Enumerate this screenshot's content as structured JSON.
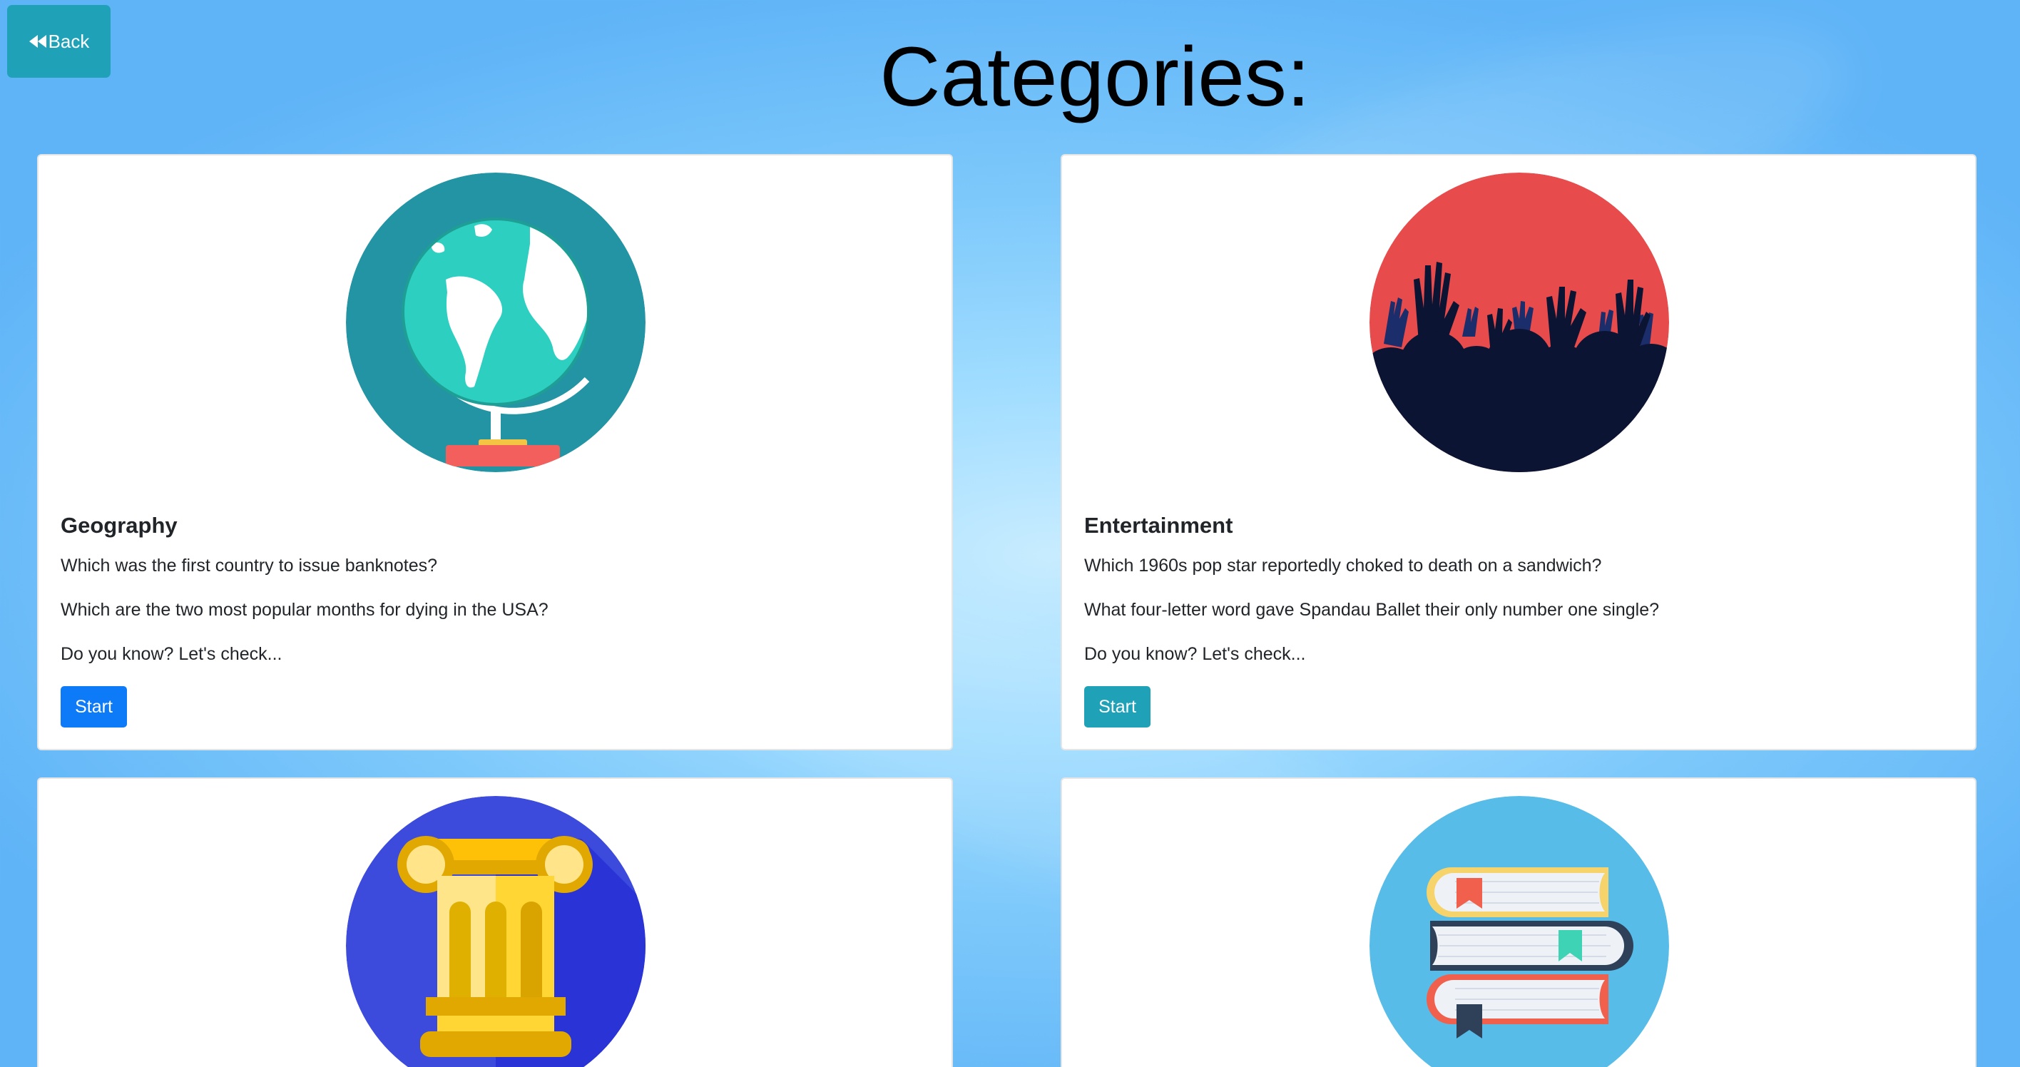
{
  "header": {
    "back_label": "Back",
    "title": "Categories:"
  },
  "colors": {
    "back_button": "#1fa2b8",
    "primary_button": "#0d7af7",
    "info_button": "#1fa2b8",
    "card_background": "#ffffff"
  },
  "cards": [
    {
      "title": "Geography",
      "icon": "globe-icon",
      "questions": [
        "Which was the first country to issue banknotes?",
        "Which are the two most popular months for dying in the USA?"
      ],
      "prompt": "Do you know? Let's check...",
      "button_label": "Start"
    },
    {
      "title": "Entertainment",
      "icon": "concert-crowd-icon",
      "questions": [
        "Which 1960s pop star reportedly choked to death on a sandwich?",
        "What four-letter word gave Spandau Ballet their only number one single?"
      ],
      "prompt": "Do you know? Let's check...",
      "button_label": "Start"
    },
    {
      "icon": "column-pillar-icon"
    },
    {
      "icon": "books-stack-icon"
    }
  ]
}
